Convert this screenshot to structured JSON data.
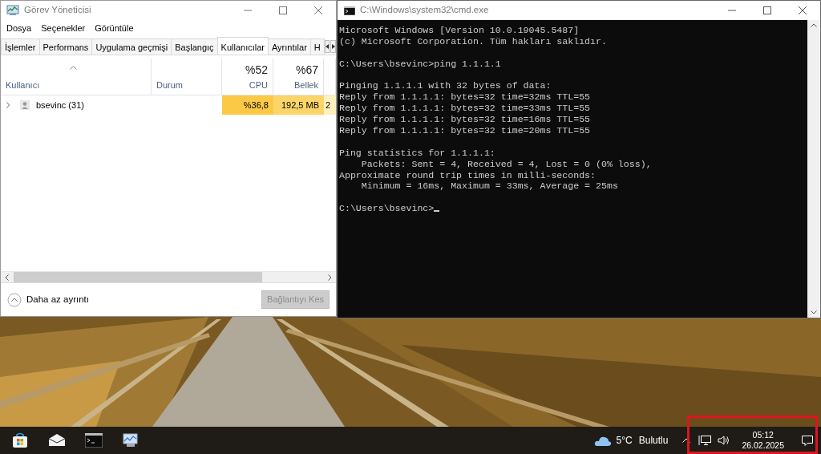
{
  "task_manager": {
    "title": "Görev Yöneticisi",
    "menu": [
      "Dosya",
      "Seçenekler",
      "Görüntüle"
    ],
    "tabs": [
      {
        "label": "İşlemler",
        "selected": false
      },
      {
        "label": "Performans",
        "selected": false
      },
      {
        "label": "Uygulama geçmişi",
        "selected": false
      },
      {
        "label": "Başlangıç",
        "selected": false
      },
      {
        "label": "Kullanıcılar",
        "selected": true
      },
      {
        "label": "Ayrıntılar",
        "selected": false
      },
      {
        "label": "H",
        "selected": false
      }
    ],
    "columns": [
      {
        "label": "Kullanıcı",
        "sorted": true
      },
      {
        "label": "Durum",
        "sorted": false
      },
      {
        "label": "CPU",
        "total": "%52",
        "sorted": false
      },
      {
        "label": "Bellek",
        "total": "%67",
        "sorted": false
      },
      {
        "sorted": false
      }
    ],
    "rows": [
      {
        "expanded": false,
        "cells": [
          {
            "text": "bsevinc (31)"
          },
          {
            "text": ""
          },
          {
            "text": "%36,8",
            "color": "#fcc947"
          },
          {
            "text": "192,5 MB",
            "color": "#fcd56a"
          },
          {
            "text": "2",
            "color": "#fff0c0"
          }
        ]
      }
    ],
    "toggle": "Daha az ayrıntı",
    "button": {
      "label": "Bağlantıyı Kes",
      "disabled": true
    }
  },
  "console": {
    "title": "C:\\Windows\\system32\\cmd.exe",
    "blocks": [
      [
        "Microsoft Windows [Version 10.0.19045.5487]",
        "(c) Microsoft Corporation. Tüm hakları saklıdır."
      ],
      [
        "C:\\Users\\bsevinc>ping 1.1.1.1"
      ],
      [
        "Pinging 1.1.1.1 with 32 bytes of data:",
        "Reply from 1.1.1.1: bytes=32 time=32ms TTL=55",
        "Reply from 1.1.1.1: bytes=32 time=33ms TTL=55",
        "Reply from 1.1.1.1: bytes=32 time=16ms TTL=55",
        "Reply from 1.1.1.1: bytes=32 time=20ms TTL=55"
      ],
      [
        "Ping statistics for 1.1.1.1:",
        "    Packets: Sent = 4, Received = 4, Lost = 0 (0% loss),",
        "Approximate round trip times in milli-seconds:",
        "    Minimum = 16ms, Maximum = 33ms, Average = 25ms"
      ],
      [
        "C:\\Users\\bsevinc>"
      ]
    ]
  },
  "taskbar": {
    "weather": {
      "temperature": "5°C",
      "condition": "Bulutlu"
    },
    "clock": {
      "time": "05:12",
      "date": "26.02.2025"
    }
  }
}
